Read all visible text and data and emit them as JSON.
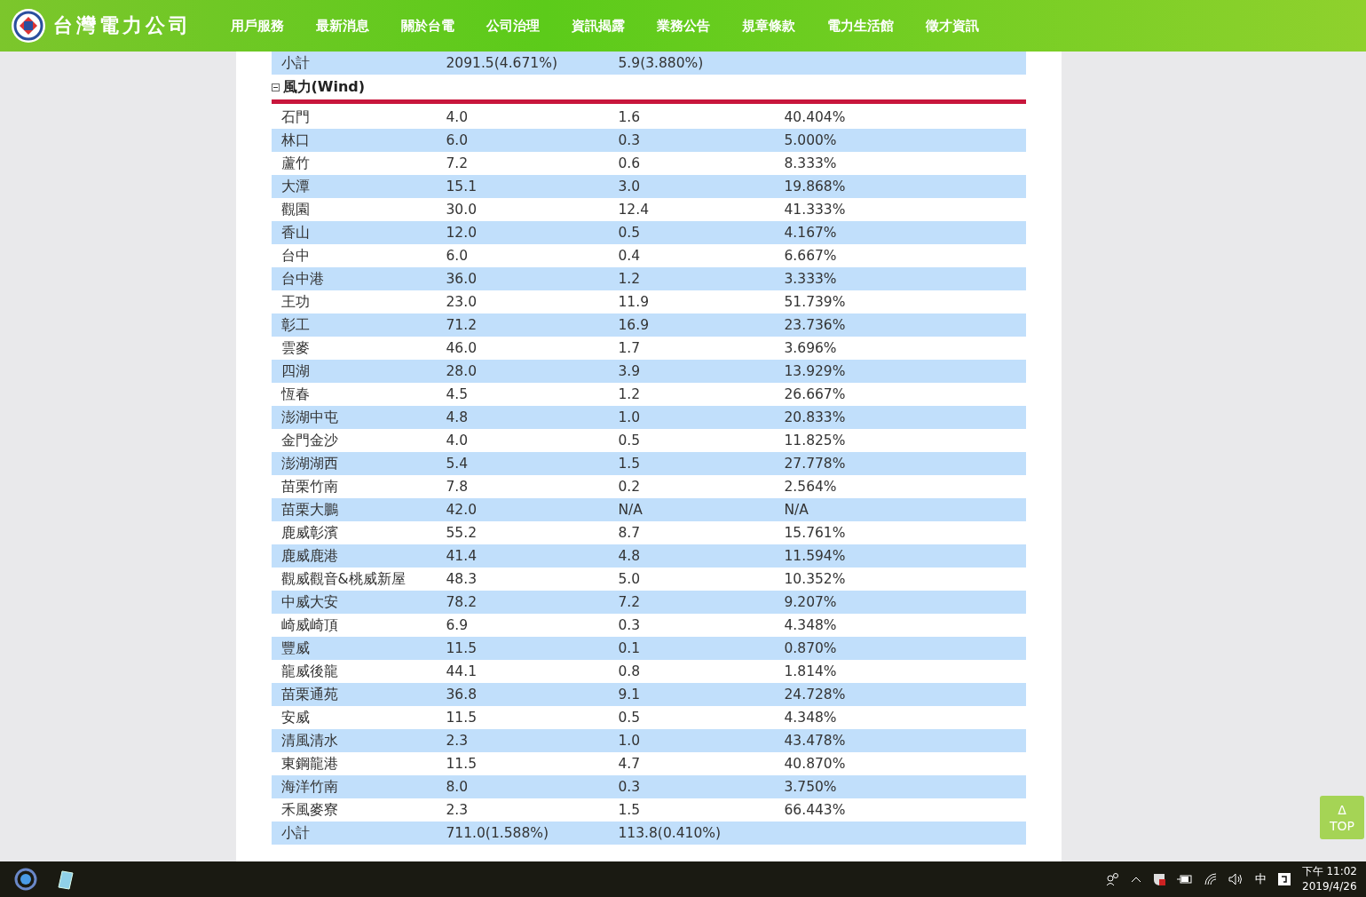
{
  "header": {
    "logo_text": "台灣電力公司",
    "nav": [
      "用戶服務",
      "最新消息",
      "關於台電",
      "公司治理",
      "資訊揭露",
      "業務公告",
      "規章條款",
      "電力生活館",
      "徵才資訊"
    ]
  },
  "table": {
    "prev_subtotal": [
      "小計",
      "2091.5(4.671%)",
      "5.9(3.880%)"
    ],
    "section": {
      "title": "風力(Wind)",
      "expanded": true
    },
    "rows": [
      [
        "石門",
        "4.0",
        "1.6",
        "40.404%"
      ],
      [
        "林口",
        "6.0",
        "0.3",
        "5.000%"
      ],
      [
        "蘆竹",
        "7.2",
        "0.6",
        "8.333%"
      ],
      [
        "大潭",
        "15.1",
        "3.0",
        "19.868%"
      ],
      [
        "觀園",
        "30.0",
        "12.4",
        "41.333%"
      ],
      [
        "香山",
        "12.0",
        "0.5",
        "4.167%"
      ],
      [
        "台中",
        "6.0",
        "0.4",
        "6.667%"
      ],
      [
        "台中港",
        "36.0",
        "1.2",
        "3.333%"
      ],
      [
        "王功",
        "23.0",
        "11.9",
        "51.739%"
      ],
      [
        "彰工",
        "71.2",
        "16.9",
        "23.736%"
      ],
      [
        "雲麥",
        "46.0",
        "1.7",
        "3.696%"
      ],
      [
        "四湖",
        "28.0",
        "3.9",
        "13.929%"
      ],
      [
        "恆春",
        "4.5",
        "1.2",
        "26.667%"
      ],
      [
        "澎湖中屯",
        "4.8",
        "1.0",
        "20.833%"
      ],
      [
        "金門金沙",
        "4.0",
        "0.5",
        "11.825%"
      ],
      [
        "澎湖湖西",
        "5.4",
        "1.5",
        "27.778%"
      ],
      [
        "苗栗竹南",
        "7.8",
        "0.2",
        "2.564%"
      ],
      [
        "苗栗大鵬",
        "42.0",
        "N/A",
        "N/A"
      ],
      [
        "鹿威彰濱",
        "55.2",
        "8.7",
        "15.761%"
      ],
      [
        "鹿威鹿港",
        "41.4",
        "4.8",
        "11.594%"
      ],
      [
        "觀威觀音&桃威新屋",
        "48.3",
        "5.0",
        "10.352%"
      ],
      [
        "中威大安",
        "78.2",
        "7.2",
        "9.207%"
      ],
      [
        "崎威崎頂",
        "6.9",
        "0.3",
        "4.348%"
      ],
      [
        "豐威",
        "11.5",
        "0.1",
        "0.870%"
      ],
      [
        "龍威後龍",
        "44.1",
        "0.8",
        "1.814%"
      ],
      [
        "苗栗通苑",
        "36.8",
        "9.1",
        "24.728%"
      ],
      [
        "安威",
        "11.5",
        "0.5",
        "4.348%"
      ],
      [
        "清風清水",
        "2.3",
        "1.0",
        "43.478%"
      ],
      [
        "東鋼龍港",
        "11.5",
        "4.7",
        "40.870%"
      ],
      [
        "海洋竹南",
        "8.0",
        "0.3",
        "3.750%"
      ],
      [
        "禾風麥寮",
        "2.3",
        "1.5",
        "66.443%"
      ]
    ],
    "subtotal": [
      "小計",
      "711.0(1.588%)",
      "113.8(0.410%)"
    ]
  },
  "top_button": {
    "arrow": "Δ",
    "label": "TOP"
  },
  "taskbar": {
    "ime": "中",
    "time": "下午 11:02",
    "date": "2019/4/26"
  }
}
